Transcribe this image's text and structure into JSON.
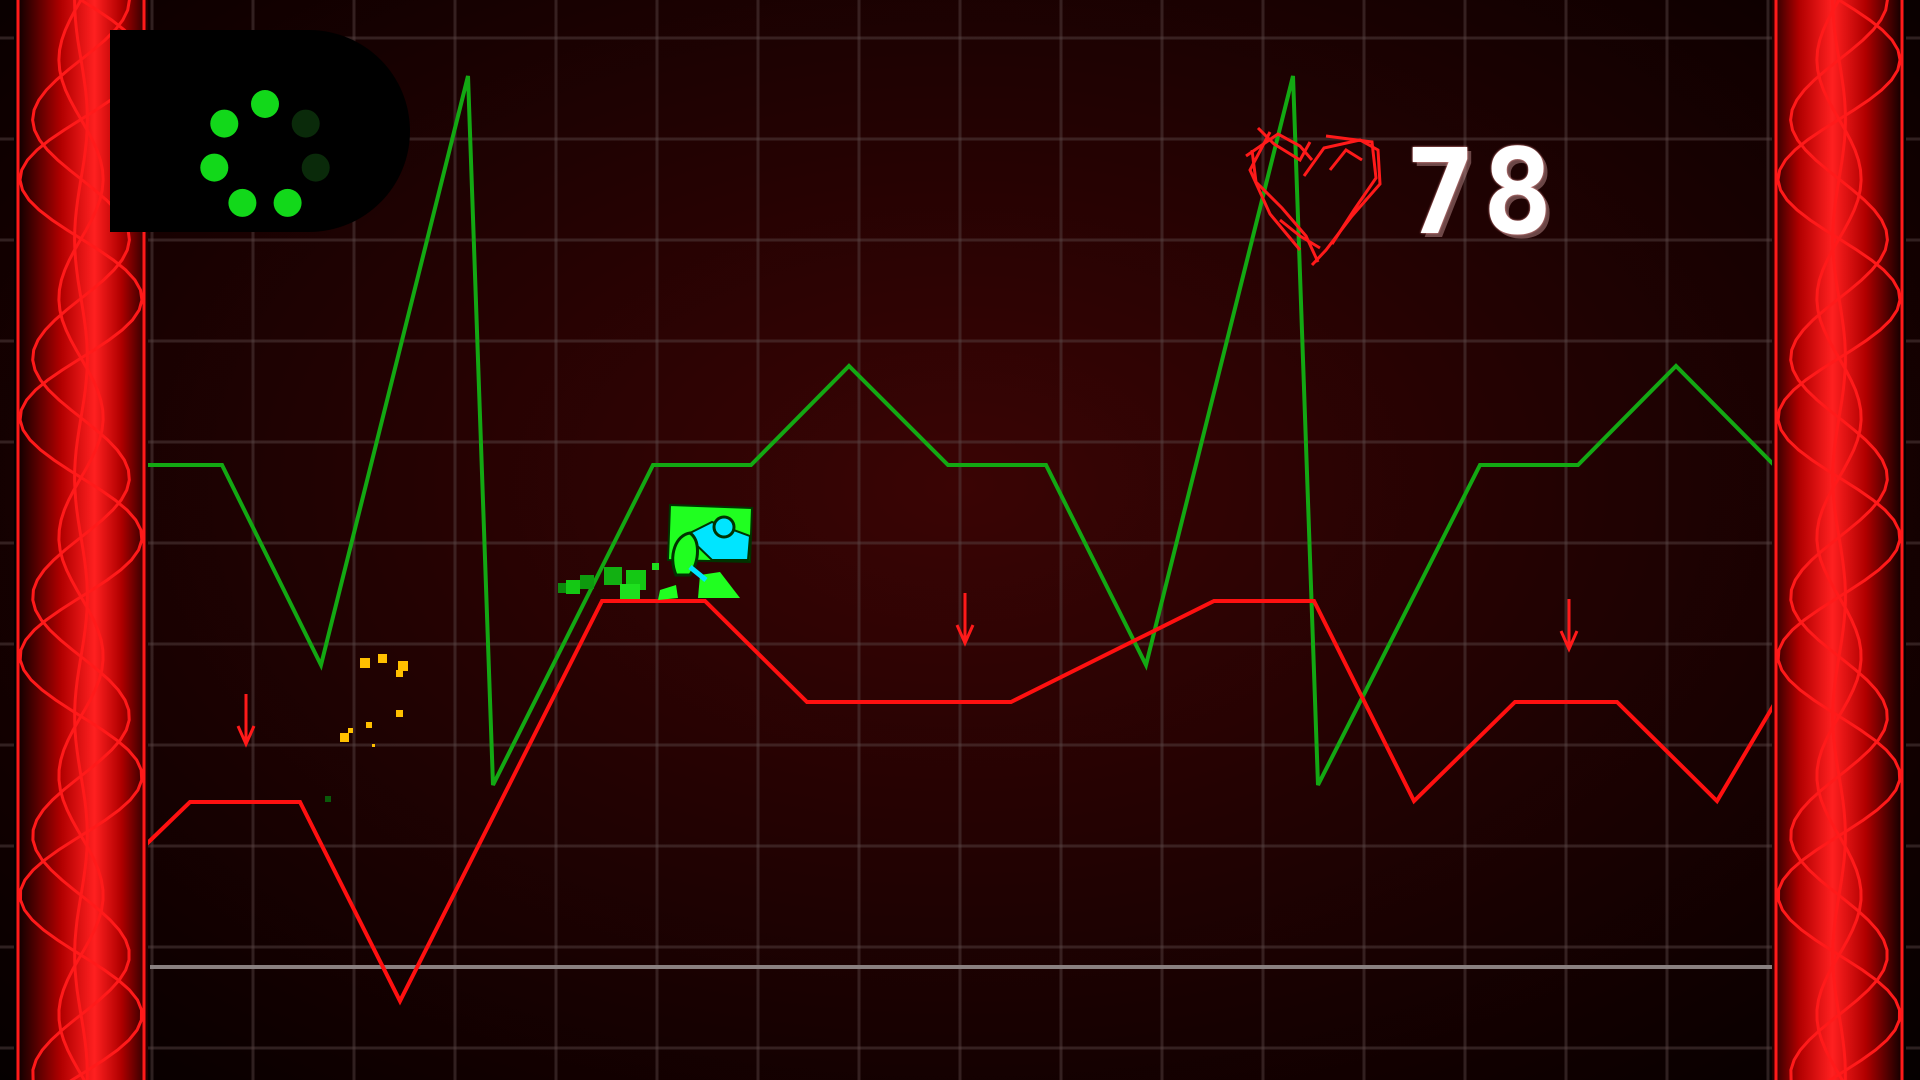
{
  "hud": {
    "score": "78",
    "progress_dots_total": 7,
    "progress_dots_filled": 5
  },
  "icons": {
    "heart": "heart-outline-icon",
    "player": "cube-player-icon",
    "hazard": "down-arrow-spike-icon"
  },
  "colors": {
    "green_line": "#13a813",
    "red_line": "#ff1010",
    "player_green": "#20ff20",
    "player_cyan": "#00e5ff",
    "dot_on": "#12d81a",
    "dot_off": "#0a2a0a",
    "wall_red": "#ff0000",
    "spark_yellow": "#ffc000"
  }
}
